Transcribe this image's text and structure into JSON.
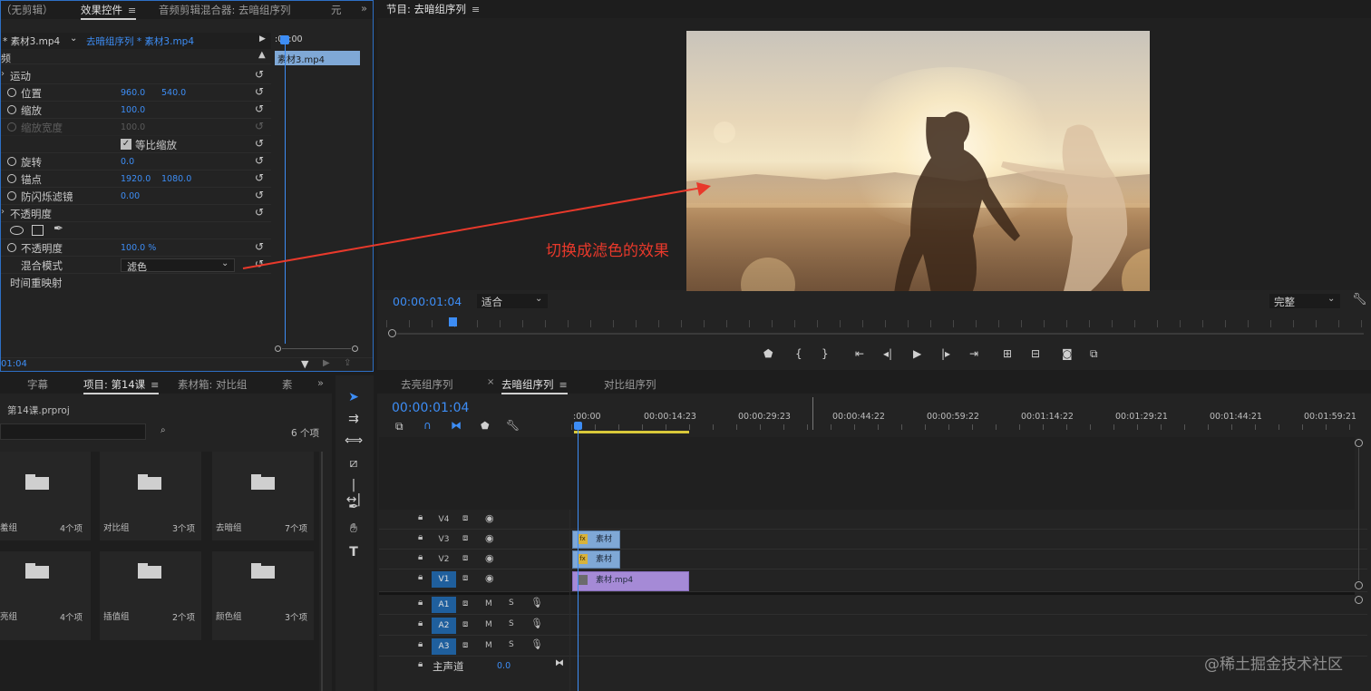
{
  "effect_controls": {
    "tabs": [
      "（无剪辑）",
      "效果控件",
      "音频剪辑混合器: 去暗组序列",
      "元"
    ],
    "active_tab": "效果控件",
    "source_clip": "* 素材3.mp4",
    "sequence_clip": "去暗组序列 * 素材3.mp4",
    "header_time": ":00:00",
    "header_label": "频",
    "timeline_clip_label": "素材3.mp4",
    "sections": {
      "motion": "运动",
      "opacity": "不透明度",
      "time_remap": "时间重映射"
    },
    "props": {
      "position": {
        "label": "位置",
        "x": "960.0",
        "y": "540.0"
      },
      "scale": {
        "label": "缩放",
        "value": "100.0"
      },
      "scale_width": {
        "label": "缩放宽度",
        "value": "100.0"
      },
      "uniform_scale": {
        "label": "等比缩放",
        "checked": true
      },
      "rotation": {
        "label": "旋转",
        "value": "0.0"
      },
      "anchor": {
        "label": "锚点",
        "x": "1920.0",
        "y": "1080.0"
      },
      "anti_flicker": {
        "label": "防闪烁滤镜",
        "value": "0.00"
      },
      "opacity": {
        "label": "不透明度",
        "value": "100.0 %"
      },
      "blend_mode": {
        "label": "混合模式",
        "value": "滤色"
      }
    },
    "footer_time": "01:04"
  },
  "program_monitor": {
    "title": "节目: 去暗组序列",
    "timecode": "00:00:01:04",
    "fit_label": "适合",
    "quality_label": "完整",
    "annotation": "切换成滤色的效果",
    "playhead_fraction": 0.07
  },
  "project_panel": {
    "tabs": [
      "字幕",
      "项目: 第14课",
      "素材箱: 对比组",
      "素"
    ],
    "active_tab": "项目: 第14课",
    "project_file": "第14课.prproj",
    "item_count": "6 个项",
    "bins": [
      {
        "name": "羞组",
        "count": "4个项"
      },
      {
        "name": "对比组",
        "count": "3个项"
      },
      {
        "name": "去暗组",
        "count": "7个项"
      },
      {
        "name": "亮组",
        "count": "4个项"
      },
      {
        "name": "插值组",
        "count": "2个项"
      },
      {
        "name": "颜色组",
        "count": "3个项"
      }
    ]
  },
  "timeline": {
    "tabs": [
      "去亮组序列",
      "去暗组序列",
      "对比组序列"
    ],
    "active_tab": "去暗组序列",
    "timecode": "00:00:01:04",
    "ruler": [
      ":00:00",
      "00:00:14:23",
      "00:00:29:23",
      "00:00:44:22",
      "00:00:59:22",
      "00:01:14:22",
      "00:01:29:21",
      "00:01:44:21",
      "00:01:59:21"
    ],
    "video_tracks": [
      "V4",
      "V3",
      "V2",
      "V1"
    ],
    "audio_tracks": [
      "A1",
      "A2",
      "A3"
    ],
    "track_m": "M",
    "track_s": "S",
    "master": {
      "label": "主声道",
      "value": "0.0"
    },
    "clips": {
      "v3": "素材",
      "v2": "素材",
      "v1": "素材.mp4"
    }
  },
  "watermark": "@稀土掘金技术社区",
  "colors": {
    "accent_blue": "#3d8df5",
    "annotation_red": "#e8392b",
    "clip_blue": "#7fa8d6",
    "clip_purple": "#a58ad6"
  }
}
